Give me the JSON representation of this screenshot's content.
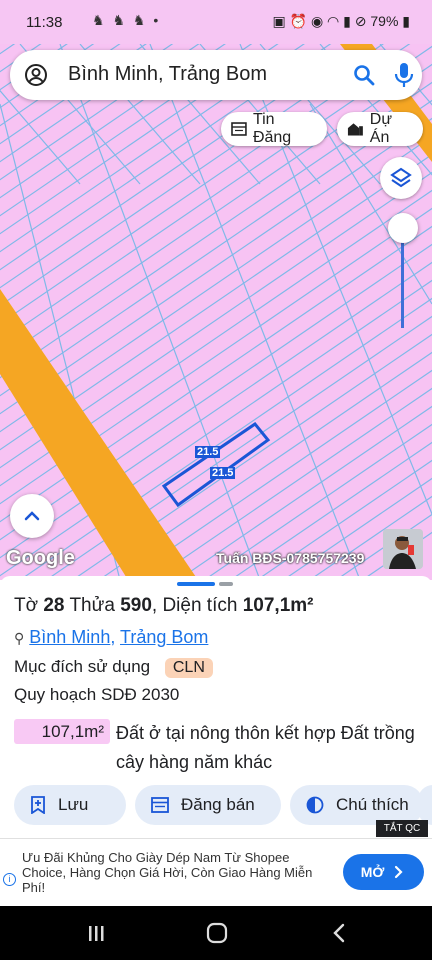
{
  "status": {
    "time": "11:38",
    "battery": "79%"
  },
  "search": {
    "text": "Bình Minh, Trảng Bom"
  },
  "chips": {
    "tin_dang": "Tin Đăng",
    "du_an": "Dự Án"
  },
  "map": {
    "google": "Google",
    "watermark": "Tuấn BĐS-0785757239",
    "plot_label_top": "21.5",
    "plot_label_bottom": "21.5",
    "colors": {
      "land": "#f7c3f3",
      "parcel_line": "#7fb9e8",
      "road": "#f5a623",
      "plot": "#1a56d6"
    }
  },
  "sheet": {
    "to_label": "Tờ",
    "to_value": "28",
    "thua_label": "Thửa",
    "thua_value": "590",
    "area_label": "Diện tích",
    "area_value": "107,1m²",
    "ward": "Bình Minh",
    "district": "Trảng Bom",
    "purpose_label": "Mục đích sử dụng",
    "purpose_code": "CLN",
    "plan_label": "Quy hoạch SDĐ 2030",
    "plan_area": "107,1m²",
    "plan_use": "Đất ở tại nông thôn kết hợp Đất trồng cây hàng năm khác",
    "buttons": {
      "save": "Lưu",
      "sell": "Đăng bán",
      "legend": "Chú thích"
    }
  },
  "ad": {
    "close": "TẮT QC",
    "text": "Ưu Đãi Khủng Cho Giày Dép Nam Từ Shopee Choice, Hàng Chọn Giá Hời, Còn Giao Hàng Miễn Phí!",
    "cta": "MỞ"
  }
}
